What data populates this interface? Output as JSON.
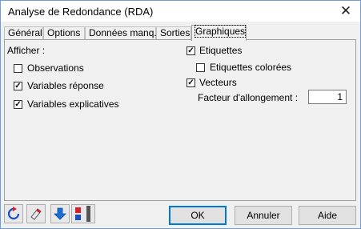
{
  "window": {
    "title": "Analyse de Redondance (RDA)",
    "close_glyph": "✕"
  },
  "tabs": [
    {
      "label": "Général"
    },
    {
      "label": "Options"
    },
    {
      "label": "Données manq."
    },
    {
      "label": "Sorties"
    },
    {
      "label": "Graphiques"
    }
  ],
  "panel": {
    "afficher_label": "Afficher :",
    "observations": {
      "label": "Observations",
      "checked": false
    },
    "variables_reponse": {
      "label": "Variables réponse",
      "checked": true
    },
    "variables_explicatives": {
      "label": "Variables explicatives",
      "checked": true
    },
    "etiquettes": {
      "label": "Etiquettes",
      "checked": true
    },
    "etiquettes_colorees": {
      "label": "Etiquettes colorées",
      "checked": false
    },
    "vecteurs": {
      "label": "Vecteurs",
      "checked": true
    },
    "facteur_label": "Facteur d'allongement :",
    "facteur_value": "1"
  },
  "buttons": {
    "ok": "OK",
    "annuler": "Annuler",
    "aide": "Aide"
  },
  "icons": [
    "reset-icon",
    "eraser-icon",
    "down-arrow-icon",
    "color-flag-icon"
  ]
}
